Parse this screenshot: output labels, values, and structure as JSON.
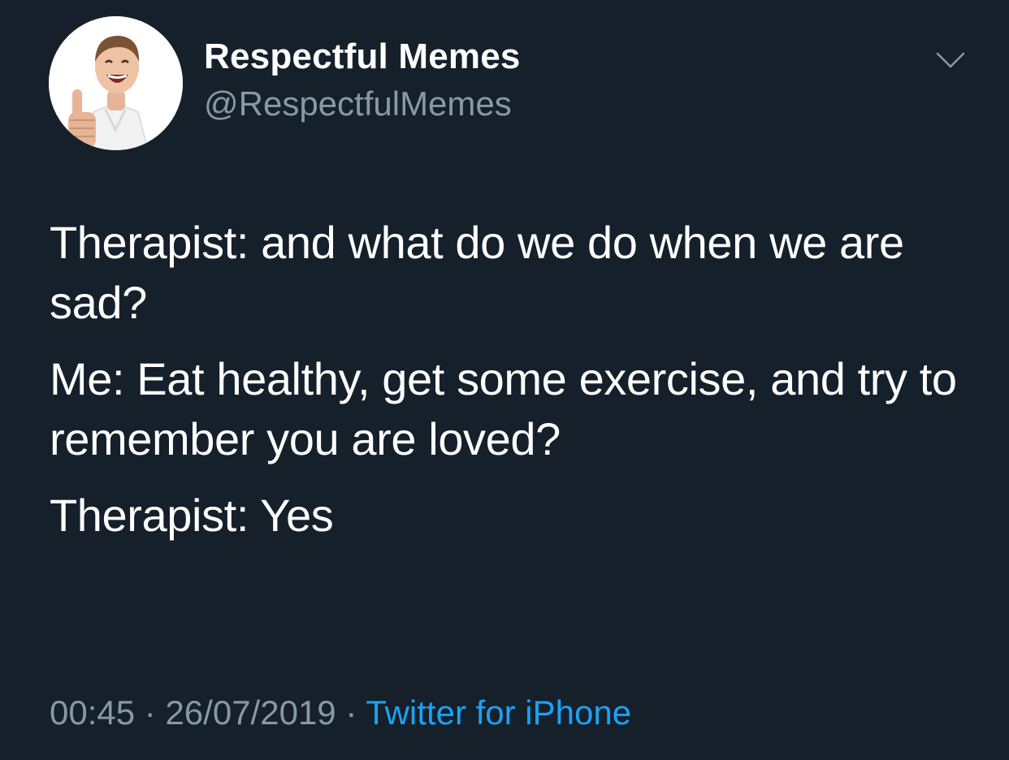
{
  "tweet": {
    "author": {
      "display_name": "Respectful Memes",
      "handle": "@RespectfulMemes",
      "avatar_icon": "profile-photo-thumbs-up"
    },
    "menu_icon": "chevron-down-icon",
    "lines": [
      "Therapist: and what do we do when we are sad?",
      "Me: Eat healthy, get some exercise, and try to remember you are loved?",
      "Therapist: Yes"
    ],
    "meta": {
      "time": "00:45",
      "separator": "·",
      "date": "26/07/2019",
      "source": "Twitter for iPhone"
    }
  },
  "colors": {
    "background": "#15202b",
    "primary_text": "#ffffff",
    "secondary_text": "#8899a6",
    "link": "#1da1f2"
  }
}
